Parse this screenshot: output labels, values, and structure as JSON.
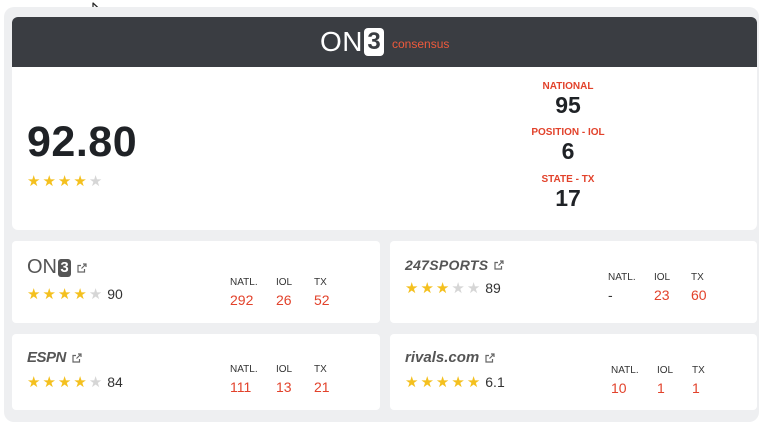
{
  "header": {
    "brand": "On3",
    "brand_on": "ON",
    "brand_num": "3",
    "subtitle": "consensus"
  },
  "consensus": {
    "score": "92.80",
    "stars": 4,
    "national_label": "NATIONAL",
    "national": "95",
    "position_label": "POSITION - IOL",
    "position": "6",
    "state_label": "STATE - TX",
    "state": "17"
  },
  "services": [
    {
      "name": "On3",
      "stars": 4,
      "rating": "90",
      "natl_label": "NATL.",
      "pos_label": "IOL",
      "state_label": "TX",
      "natl": "292",
      "pos": "26",
      "state": "52"
    },
    {
      "name": "247Sports",
      "logo_text": "247SPORTS",
      "stars": 3,
      "rating": "89",
      "natl_label": "NATL.",
      "pos_label": "IOL",
      "state_label": "TX",
      "natl": "-",
      "pos": "23",
      "state": "60"
    },
    {
      "name": "ESPN",
      "logo_text": "ESPN",
      "stars": 4,
      "rating": "84",
      "natl_label": "NATL.",
      "pos_label": "IOL",
      "state_label": "TX",
      "natl": "111",
      "pos": "13",
      "state": "21"
    },
    {
      "name": "Rivals",
      "logo_text": "rivals.com",
      "stars": 5,
      "rating": "6.1",
      "natl_label": "NATL.",
      "pos_label": "IOL",
      "state_label": "TX",
      "natl": "10",
      "pos": "1",
      "state": "1"
    }
  ],
  "colors": {
    "header_bg": "#3a3d42",
    "accent": "#e2422b",
    "star": "#f4c01e"
  }
}
